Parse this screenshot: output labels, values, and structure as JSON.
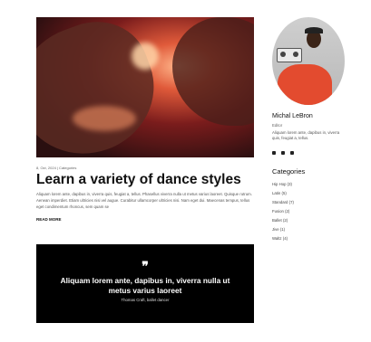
{
  "post": {
    "meta": "8, Oct, 2024 | Categories",
    "title": "Learn a variety of dance styles",
    "excerpt": "Aliquam lorem ante, dapibus in, viverra quis, feugiat a, tellus. Phasellus viverra nulla ut metus varius laoreet. Quisque rutrum. Aenean imperdiet. Etiam ultricies nisi vel augue. Curabitur ullamcorper ultricies nisi. Nam eget dui. Maecenas tempus, tellus eget condimentum rhoncus, sem quam se",
    "read_more": "READ MORE"
  },
  "quote": {
    "mark": "❞",
    "text": "Aliquam lorem ante, dapibus in, viverra nulla ut metus varius laoreet",
    "cite": "Thomas Craft, ballet dancer"
  },
  "author": {
    "name": "Michal LeBron",
    "role": "Editor",
    "bio": "Aliquam lorem ante, dapibus in, viverra quis, feugiat a, tellus."
  },
  "socials": [
    "facebook-icon",
    "instagram-icon",
    "tiktok-icon"
  ],
  "categories": {
    "heading": "Categories",
    "items": [
      {
        "label": "Hip Hop (3)"
      },
      {
        "label": "Latin (5)"
      },
      {
        "label": "Standard (7)"
      },
      {
        "label": "Fusion (2)"
      },
      {
        "label": "Ballet (2)"
      },
      {
        "label": "Jive (1)"
      },
      {
        "label": "Waltz (4)"
      }
    ]
  }
}
